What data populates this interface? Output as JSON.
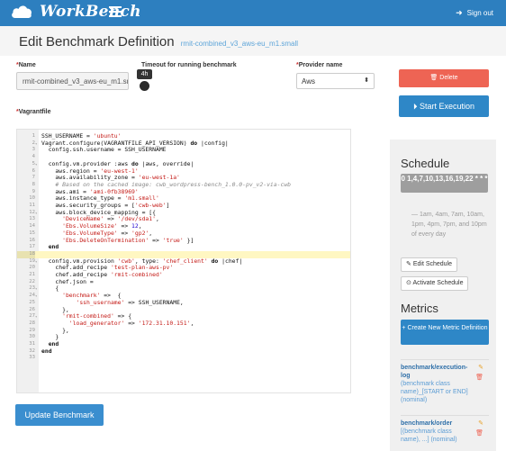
{
  "navbar": {
    "brand": "WorkBench",
    "signout_label": "Sign out",
    "color": "#2d7fbf"
  },
  "header": {
    "title": "Edit Benchmark Definition",
    "subtitle": "rmit-combined_v3_aws-eu_m1.small"
  },
  "form": {
    "name_label": "Name",
    "name_value": "rmit-combined_v3_aws-eu_m1.sm",
    "timeout_label": "Timeout for running benchmark",
    "timeout_value": "4h",
    "provider_label": "Provider name",
    "provider_value": "Aws",
    "vagrantfile_label": "Vagrantfile",
    "required_mark": "*"
  },
  "buttons": {
    "delete": "Delete",
    "start_execution": "Start Execution",
    "update": "Update Benchmark"
  },
  "code_lines": [
    "SSH_USERNAME = 'ubuntu'",
    "Vagrant.configure(VAGRANTFILE_API_VERSION) do |config|",
    "  config.ssh.username = SSH_USERNAME",
    "",
    "  config.vm.provider :aws do |aws, override|",
    "    aws.region = 'eu-west-1'",
    "    aws.availability_zone = 'eu-west-1a'",
    "    # Based on the cached image: cwb_wordpress-bench_1.0.0-pv_v2-via-cwb",
    "    aws.ami = 'ami-0fb38969'",
    "    aws.instance_type = 'm1.small'",
    "    aws.security_groups = ['cwb-web']",
    "    aws.block_device_mapping = [{",
    "      'DeviceName' => '/dev/sda1',",
    "      'Ebs.VolumeSize' => 12,",
    "      'Ebs.VolumeType' => 'gp2',",
    "      'Ebs.DeleteOnTermination' => 'true' }]",
    "  end",
    "",
    "  config.vm.provision 'cwb', type: 'chef_client' do |chef|",
    "    chef.add_recipe 'test-plan-aws-pv'",
    "    chef.add_recipe 'rmit-combined'",
    "    chef.json =",
    "    {",
    "      'benchmark' =>  {",
    "          'ssh_username' => SSH_USERNAME,",
    "      },",
    "      'rmit-combined' => {",
    "        'load_generator' => '172.31.10.151',",
    "      },",
    "    }",
    "  end",
    "end",
    ""
  ],
  "schedule": {
    "heading": "Schedule",
    "cron": "0 1,4,7,10,13,16,19,22 * * *",
    "description": "— 1am, 4am, 7am, 10am, 1pm, 4pm, 7pm, and 10pm of every day",
    "edit_label": "Edit Schedule",
    "activate_label": "Activate Schedule"
  },
  "metrics": {
    "heading": "Metrics",
    "create_label": "Create New Metric Definition",
    "items": [
      {
        "name": "benchmark/execution-log",
        "desc": "(benchmark class name)_[START or END] (nominal)"
      },
      {
        "name": "benchmark/order",
        "desc": "[(benchmark class name), ...] (nominal)"
      }
    ]
  }
}
